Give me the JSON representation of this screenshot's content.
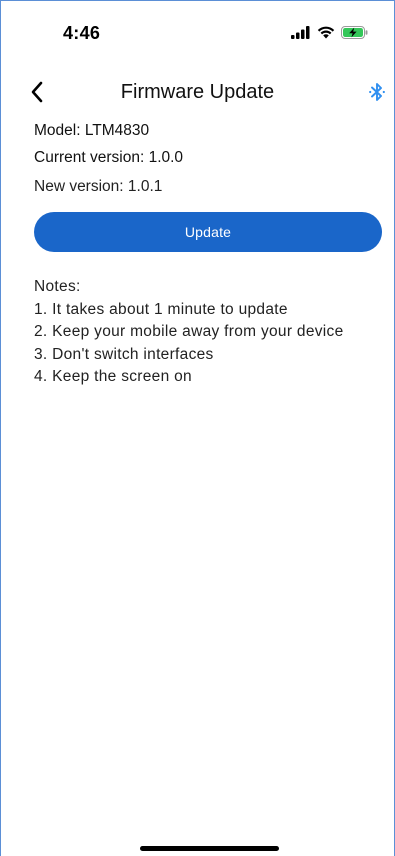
{
  "status_bar": {
    "time": "4:46",
    "icons": [
      "cellular-signal-icon",
      "wifi-icon",
      "battery-charging-icon"
    ],
    "battery_color": "#34c759"
  },
  "nav": {
    "title": "Firmware Update",
    "back_icon": "chevron-left-icon",
    "bluetooth_icon": "bluetooth-icon",
    "bluetooth_color": "#2f8ff0"
  },
  "device": {
    "model": "Model: LTM4830",
    "current_version": "Current version: 1.0.0",
    "new_version": "New version: 1.0.1"
  },
  "actions": {
    "update_label": "Update",
    "update_color": "#1a66c9"
  },
  "notes": {
    "title": "Notes:",
    "items": [
      "1. It takes about 1 minute to update",
      "2. Keep your mobile away from your device",
      "3. Don't switch interfaces",
      "4. Keep the screen on"
    ]
  }
}
